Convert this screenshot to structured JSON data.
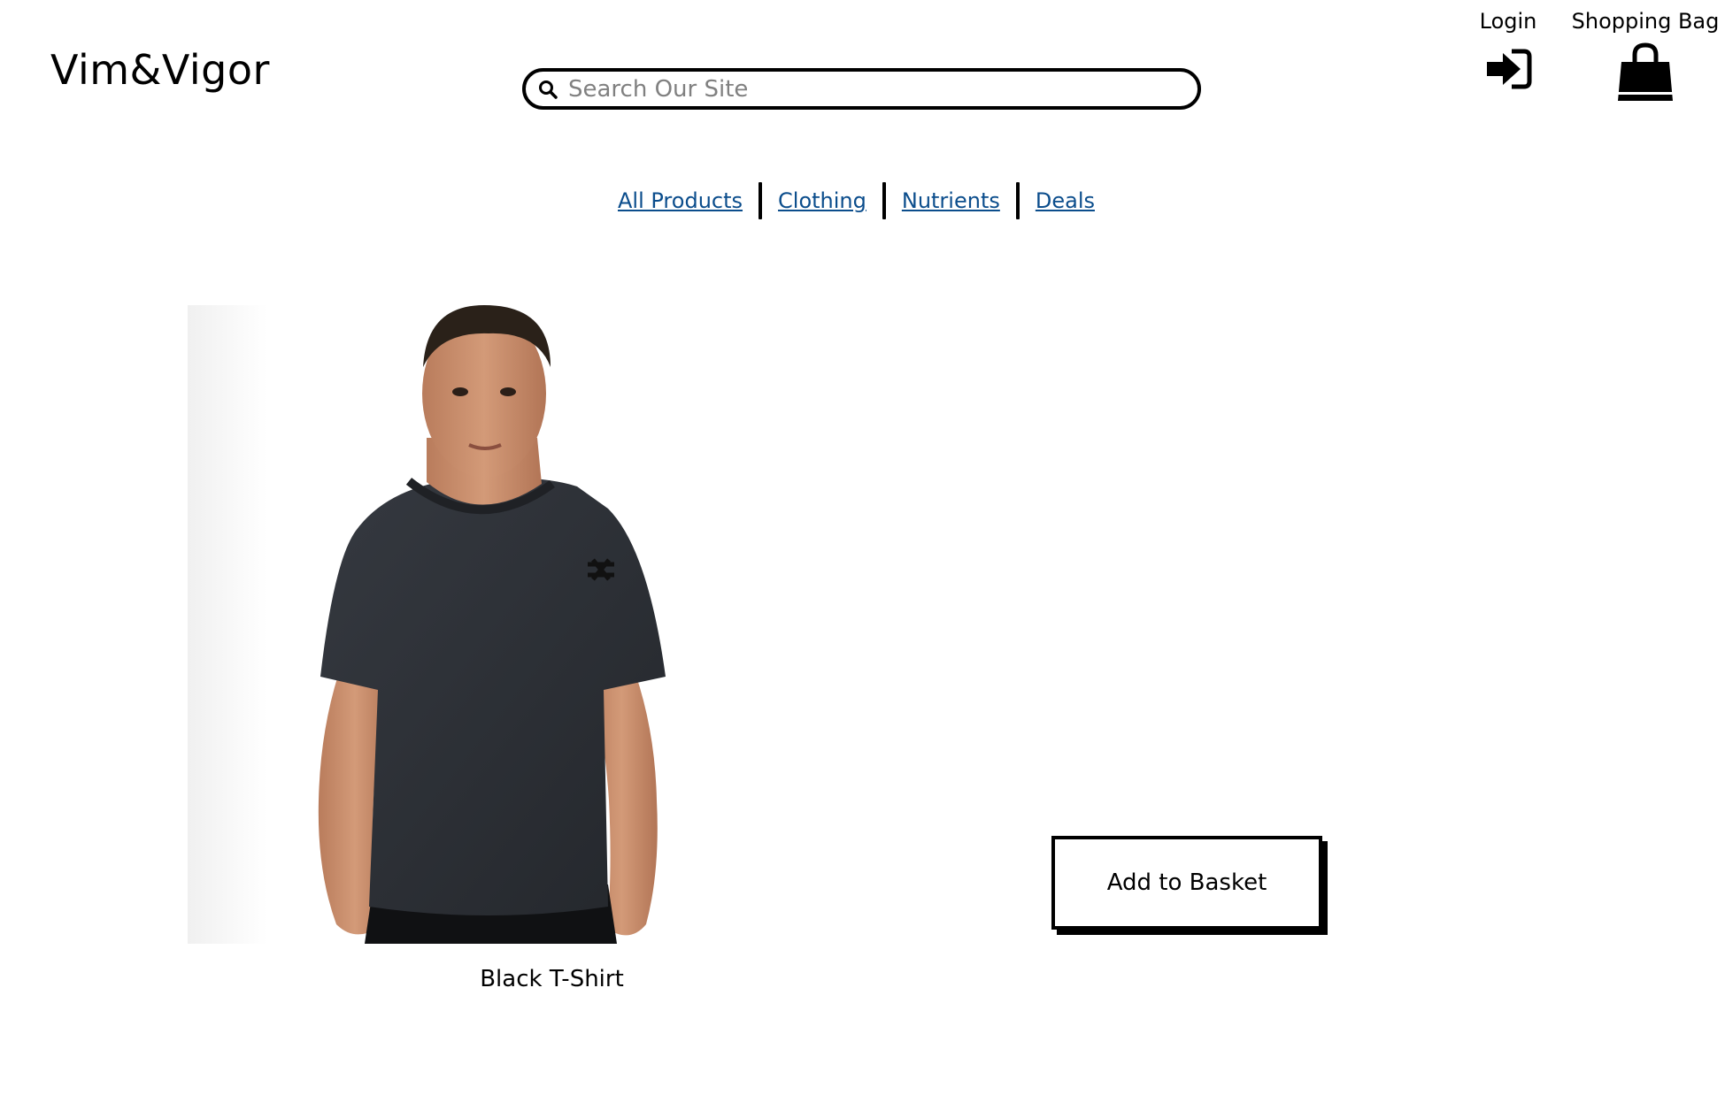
{
  "header": {
    "logo_text": "Vim&Vigor",
    "search": {
      "placeholder": "Search Our Site",
      "value": "",
      "icon": "search-icon"
    },
    "login": {
      "label": "Login",
      "icon": "sign-in-icon"
    },
    "shopping_bag": {
      "label": "Shopping Bag",
      "icon": "shopping-bag-icon"
    }
  },
  "category_nav": {
    "items": [
      {
        "label": "All Products"
      },
      {
        "label": "Clothing"
      },
      {
        "label": "Nutrients"
      },
      {
        "label": "Deals"
      }
    ],
    "link_color": "#0b4d8c"
  },
  "product": {
    "name": "Black T-Shirt",
    "image_alt": "Man wearing a black T-Shirt",
    "shirt_color": "#2b2e33",
    "add_to_basket_label": "Add to Basket"
  }
}
